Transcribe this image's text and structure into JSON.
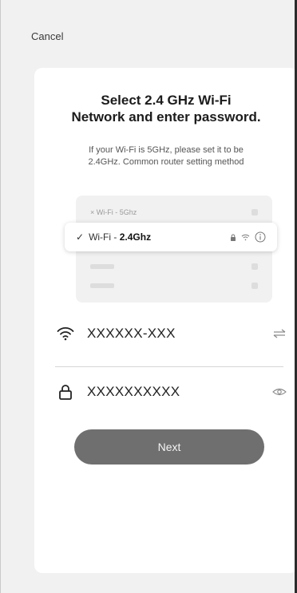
{
  "header": {
    "cancel_label": "Cancel"
  },
  "main": {
    "title_line1": "Select 2.4 GHz Wi-Fi",
    "title_line2": "Network and enter password.",
    "subtitle_line1": "If your Wi-Fi is 5GHz, please set it to be",
    "subtitle_line2": "2.4GHz. Common router setting method",
    "illustration": {
      "row_5g_mark": "×",
      "row_5g_label": "Wi-Fi - 5Ghz",
      "selected_mark": "✓",
      "selected_prefix": "Wi-Fi - ",
      "selected_band": "2.4Ghz"
    },
    "wifi_field": {
      "value": "XXXXXX-XXX",
      "icon": "wifi-icon",
      "action_icon": "switch-network-icon"
    },
    "password_field": {
      "value": "XXXXXXXXXX",
      "icon": "lock-icon",
      "action_icon": "eye-icon"
    },
    "next_label": "Next"
  },
  "colors": {
    "background": "#f1f1f1",
    "card": "#ffffff",
    "button": "#6f6f6f",
    "text": "#1f1f1f"
  }
}
